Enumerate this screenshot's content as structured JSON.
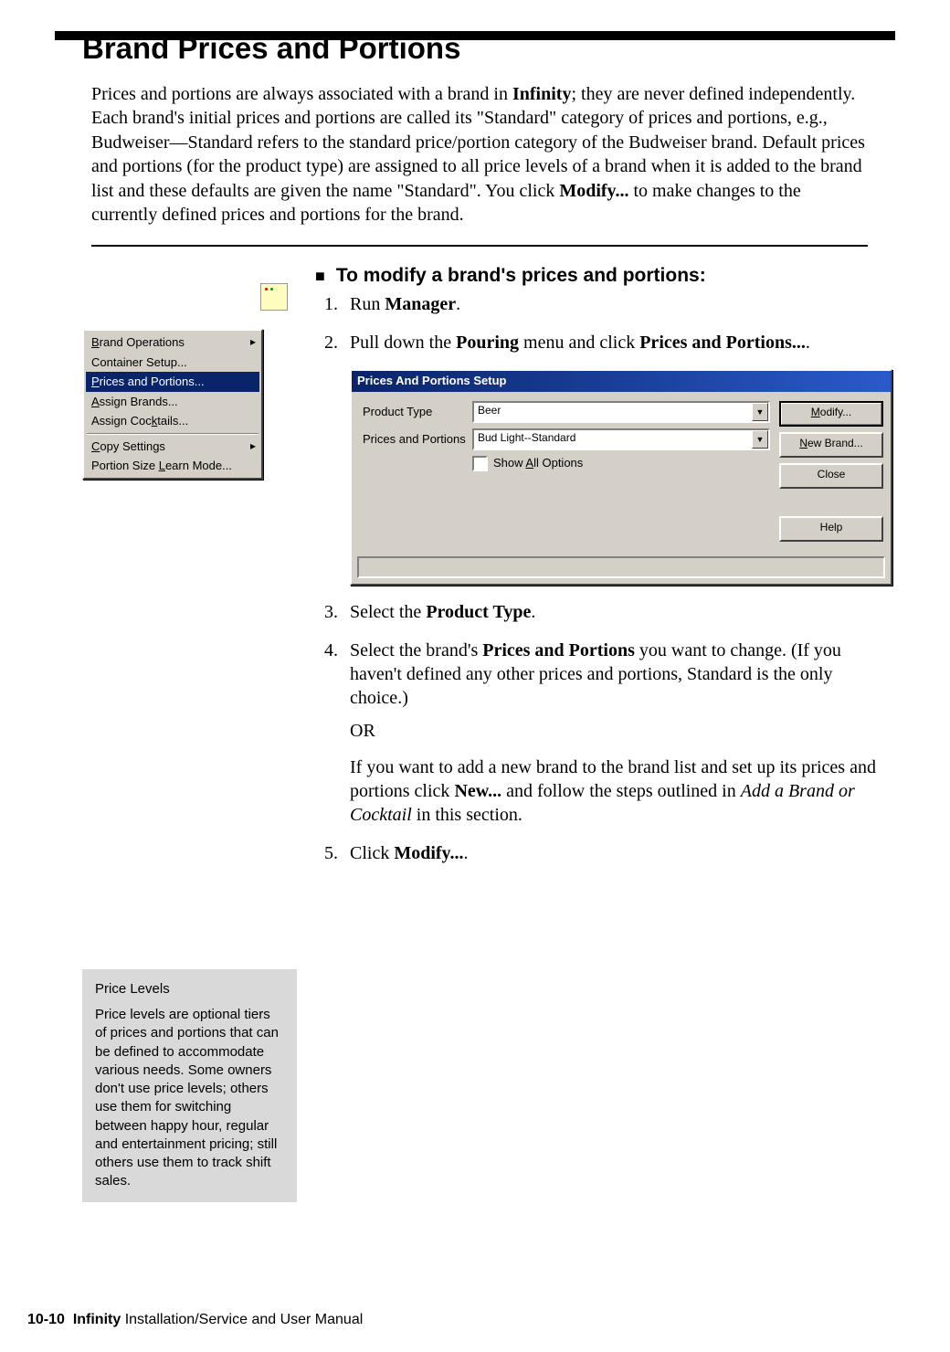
{
  "page": {
    "number": "10-10",
    "product": "Infinity",
    "manual_title": "Installation/Service and User Manual"
  },
  "heading": "Brand Prices and Portions",
  "intro": {
    "part1": "Prices and portions are always associated with a brand in ",
    "bold1": "Infinity",
    "part2": "; they are never defined independently. Each brand's initial prices and portions are called its \"Standard\" category of prices and portions, e.g., Budweiser—Standard refers to the standard price/portion category of the Budweiser brand. Default prices and portions (for the product type) are assigned to all price levels of a brand when it is added to the brand list and these defaults are given the name \"Standard\". You click ",
    "bold2": "Modify...",
    "part3": " to make changes to the currently defined prices and portions for the brand."
  },
  "task_heading": "To modify a brand's prices and portions:",
  "steps": {
    "s1": {
      "pre": "Run ",
      "bold": "Manager",
      "post": "."
    },
    "s2": {
      "pre": "Pull down the ",
      "bold1": "Pouring",
      "mid": " menu and click ",
      "bold2": "Prices and Portions...",
      "post": "."
    },
    "s3": {
      "pre": "Select the ",
      "bold": "Product Type",
      "post": "."
    },
    "s4": {
      "pre": "Select the brand's ",
      "bold1": "Prices and Portions",
      "post1": " you want to change. (If you haven't defined any other prices and portions, Standard is the only choice.)",
      "or": "OR",
      "after_pre": "If you want to add a new brand to the brand list and set up its prices and portions click ",
      "bold2": "New...",
      "after_mid": " and follow the steps outlined in ",
      "ital": "Add a Brand or Cocktail",
      "after_post": " in this section."
    },
    "s5": {
      "pre": "Click ",
      "bold": "Modify...",
      "post": "."
    }
  },
  "menu": {
    "items": [
      {
        "label": "Brand Operations",
        "underline_index": 0,
        "arrow": true
      },
      {
        "label": "Container Setup...",
        "underline_index": -1
      },
      {
        "label": "Prices and Portions...",
        "underline_index": 0,
        "selected": true
      },
      {
        "label": "Assign Brands...",
        "underline_index": 0
      },
      {
        "label": "Assign Cocktails...",
        "underline_index": 10
      }
    ],
    "items2": [
      {
        "label": "Copy Settings",
        "underline_index": 0,
        "arrow": true
      },
      {
        "label": "Portion Size Learn Mode...",
        "underline_index": 13
      }
    ]
  },
  "dialog": {
    "title": "Prices And Portions Setup",
    "product_type_label": "Product Type",
    "product_type_value": "Beer",
    "prices_label": "Prices and Portions",
    "prices_value": "Bud Light--Standard",
    "show_all": "Show All Options",
    "show_all_underline_index": 5,
    "buttons": {
      "modify": "Modify...",
      "modify_underline_index": 0,
      "newbrand": "New Brand...",
      "newbrand_underline_index": 0,
      "close": "Close",
      "help": "Help"
    }
  },
  "sidebar": {
    "title": "Price Levels",
    "body": "Price levels are optional tiers of prices and portions that can be defined to accommodate various needs. Some owners don't use price levels; others use them for switching between happy hour, regular and entertainment pricing; still others use them to track shift sales."
  }
}
